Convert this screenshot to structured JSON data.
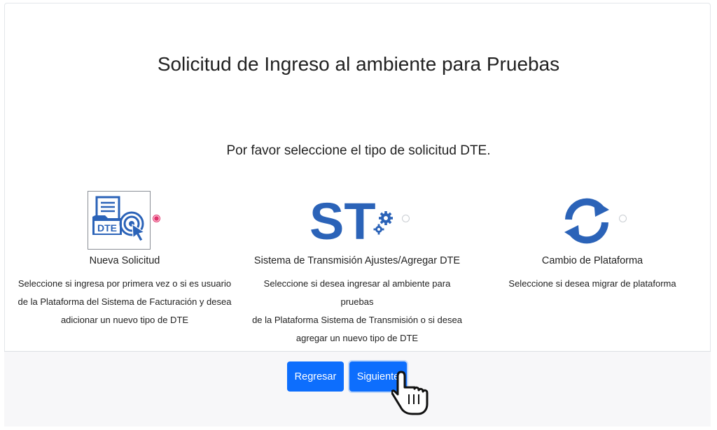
{
  "page": {
    "title": "Solicitud de Ingreso al ambiente para Pruebas",
    "subtitle": "Por favor seleccione el tipo de solicitud DTE."
  },
  "options": [
    {
      "title": "Nueva Solicitud",
      "desc_lines": [
        "Seleccione si ingresa por primera vez o si es usuario",
        "de la Plataforma del Sistema de Facturación y desea",
        "adicionar un nuevo tipo de DTE"
      ],
      "icon": "dte-document-target-icon",
      "icon_text": "DTE",
      "selected": true
    },
    {
      "title": "Sistema de Transmisión Ajustes/Agregar DTE",
      "desc_lines": [
        "Seleccione si desea ingresar al ambiente para pruebas",
        "de la Plataforma Sistema de Transmisión o si desea",
        "agregar un nuevo tipo de DTE"
      ],
      "icon": "st-gears-icon",
      "icon_text": "ST",
      "selected": false
    },
    {
      "title": "Cambio de Plataforma",
      "desc_lines": [
        "Seleccione si desea migrar de plataforma"
      ],
      "icon": "sync-arrows-icon",
      "selected": false
    }
  ],
  "buttons": {
    "back": "Regresar",
    "next": "Siguiente"
  },
  "colors": {
    "primary": "#0d6efd",
    "icon_blue": "#2b63b8",
    "radio_selected": "#e0336c"
  }
}
